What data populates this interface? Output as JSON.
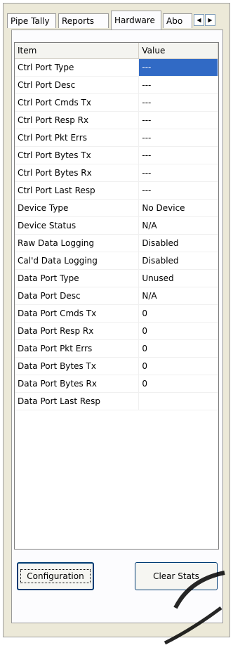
{
  "tabs": [
    {
      "label": "Pipe Tally"
    },
    {
      "label": "Reports"
    },
    {
      "label": "Hardware"
    },
    {
      "label": "Abo"
    }
  ],
  "icons": {
    "scroll_left": "arrow-left-icon",
    "scroll_right": "arrow-right-icon"
  },
  "grid": {
    "headers": {
      "item": "Item",
      "value": "Value"
    },
    "rows": [
      {
        "item": "Ctrl Port Type",
        "value": "---"
      },
      {
        "item": "Ctrl Port Desc",
        "value": "---"
      },
      {
        "item": "Ctrl Port Cmds Tx",
        "value": "---"
      },
      {
        "item": "Ctrl Port Resp Rx",
        "value": "---"
      },
      {
        "item": "Ctrl Port Pkt Errs",
        "value": "---"
      },
      {
        "item": "Ctrl Port Bytes Tx",
        "value": "---"
      },
      {
        "item": "Ctrl Port Bytes Rx",
        "value": "---"
      },
      {
        "item": "Ctrl Port Last Resp",
        "value": "---"
      },
      {
        "item": "Device Type",
        "value": "No Device"
      },
      {
        "item": "Device Status",
        "value": "N/A"
      },
      {
        "item": "Raw Data Logging",
        "value": "Disabled"
      },
      {
        "item": "Cal'd Data Logging",
        "value": "Disabled"
      },
      {
        "item": "Data Port Type",
        "value": "Unused"
      },
      {
        "item": "Data Port Desc",
        "value": "N/A"
      },
      {
        "item": "Data Port Cmds Tx",
        "value": "0"
      },
      {
        "item": "Data Port Resp Rx",
        "value": "0"
      },
      {
        "item": "Data Port Pkt Errs",
        "value": "0"
      },
      {
        "item": "Data Port Bytes Tx",
        "value": "0"
      },
      {
        "item": "Data Port Bytes Rx",
        "value": "0"
      },
      {
        "item": "Data Port Last Resp",
        "value": ""
      }
    ]
  },
  "buttons": {
    "configuration": "Configuration",
    "clear_stats": "Clear Stats"
  },
  "colors": {
    "selection": "#316ac5",
    "panel": "#ece9d8",
    "button_border": "#003c74"
  }
}
